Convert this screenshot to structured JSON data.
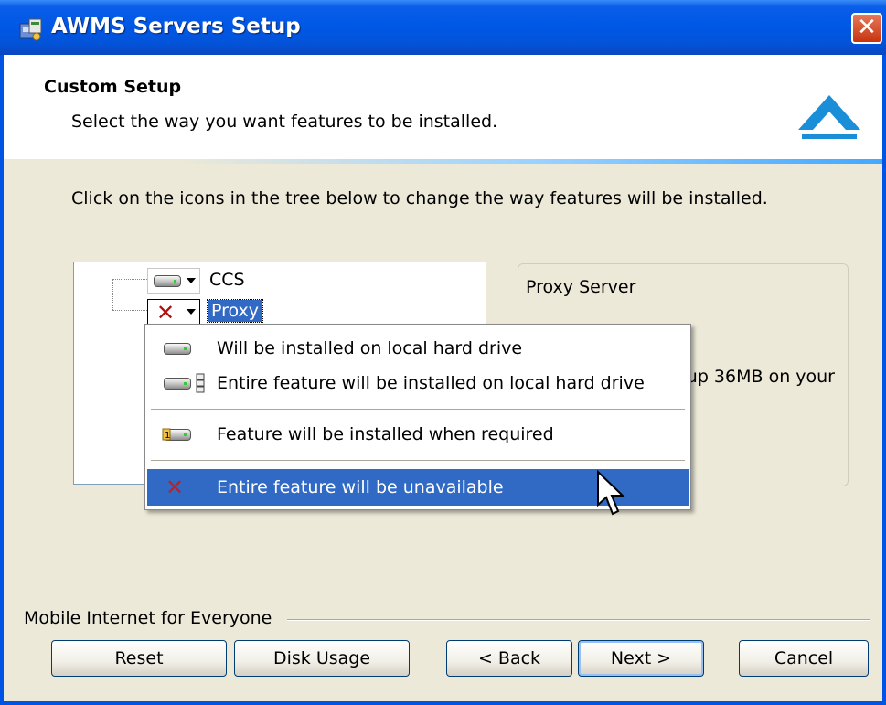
{
  "window": {
    "title": "AWMS Servers Setup",
    "close_label": "✕"
  },
  "header": {
    "title": "Custom Setup",
    "subtitle": "Select the way you want features to be installed."
  },
  "instruction": "Click on the icons in the tree below to change the way features will be installed.",
  "tree": {
    "items": [
      {
        "label": "CCS",
        "icon": "hard-drive-icon",
        "selected": false
      },
      {
        "label": "Proxy",
        "icon": "unavailable-x-icon",
        "selected": true
      }
    ]
  },
  "description": {
    "title": "Proxy Server",
    "text_visible": "up 36MB on your"
  },
  "context_menu": {
    "items": [
      {
        "label": "Will be installed on local hard drive",
        "icon": "hard-drive-icon"
      },
      {
        "label": "Entire feature will be installed on local hard drive",
        "icon": "hard-drive-tree-icon"
      },
      {
        "label": "Feature will be installed when required",
        "icon": "install-on-demand-icon"
      },
      {
        "label": "Entire feature will be unavailable",
        "icon": "unavailable-x-icon",
        "highlighted": true
      }
    ]
  },
  "footer": {
    "brand": "Mobile Internet for Everyone",
    "buttons": {
      "reset": "Reset",
      "disk_usage": "Disk Usage",
      "back": "< Back",
      "next": "Next >",
      "cancel": "Cancel"
    }
  },
  "colors": {
    "titlebar": "#0058e6",
    "selection": "#316ac5",
    "unavailable_x": "#b01010",
    "logo": "#1a8fd8"
  }
}
